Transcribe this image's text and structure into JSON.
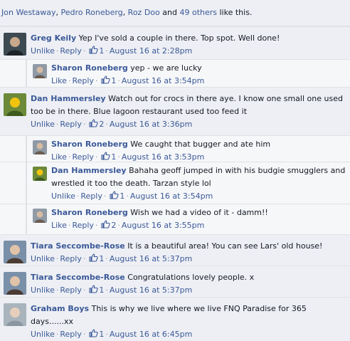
{
  "likes_bar": {
    "names": [
      "Jon Westaway",
      "Pedro Roneberg",
      "Roz Doo"
    ],
    "sep": ", ",
    "and": " and ",
    "others": "49 others",
    "suffix": " like this."
  },
  "labels": {
    "unlike": "Unlike",
    "like": "Like",
    "reply": "Reply",
    "dot": "·"
  },
  "colors": {
    "link": "#3b5998",
    "meta": "#9197a3",
    "background": "#edeff4"
  },
  "comments": [
    {
      "author": "Greg Keily",
      "text": "Yep I've sold a couple in there. Top spot. Well done!",
      "action": "Unlike",
      "likes": "1",
      "time": "August 16 at 2:28pm",
      "avatar": "avatar-greg"
    },
    {
      "author": "Sharon Roneberg",
      "text": "yep - we are lucky",
      "action": "Like",
      "likes": "1",
      "time": "August 16 at 3:54pm",
      "avatar": "avatar-sharon",
      "reply": true
    },
    {
      "author": "Dan Hammersley",
      "text": "Watch out for crocs in there aye. I know one small one used too be in there. Blue lagoon restaurant used too feed it",
      "action": "Unlike",
      "likes": "2",
      "time": "August 16 at 3:36pm",
      "avatar": "avatar-dan"
    },
    {
      "author": "Sharon Roneberg",
      "text": "We caught that bugger and ate him",
      "action": "Like",
      "likes": "1",
      "time": "August 16 at 3:53pm",
      "avatar": "avatar-sharon",
      "reply": true
    },
    {
      "author": "Dan Hammersley",
      "text": "Bahaha geoff jumped in with his budgie smugglers and wrestled it too the death. Tarzan style lol",
      "action": "Unlike",
      "likes": "1",
      "time": "August 16 at 3:54pm",
      "avatar": "avatar-dan",
      "reply": true
    },
    {
      "author": "Sharon Roneberg",
      "text": "Wish we had a video of it - damm!!",
      "action": "Like",
      "likes": "2",
      "time": "August 16 at 3:55pm",
      "avatar": "avatar-sharon",
      "reply": true
    },
    {
      "author": "Tiara Seccombe-Rose",
      "text": "It is a beautiful area! You can see Lars' old house!",
      "action": "Unlike",
      "likes": "1",
      "time": "August 16 at 5:37pm",
      "avatar": "avatar-tiara"
    },
    {
      "author": "Tiara Seccombe-Rose",
      "text": "Congratulations lovely people. x",
      "action": "Unlike",
      "likes": "1",
      "time": "August 16 at 5:37pm",
      "avatar": "avatar-tiara"
    },
    {
      "author": "Graham Boys",
      "text": "This is why we live where we live FNQ Paradise for 365 days......xx",
      "action": "Unlike",
      "likes": "1",
      "time": "August 16 at 6:45pm",
      "avatar": "avatar-graham"
    }
  ]
}
